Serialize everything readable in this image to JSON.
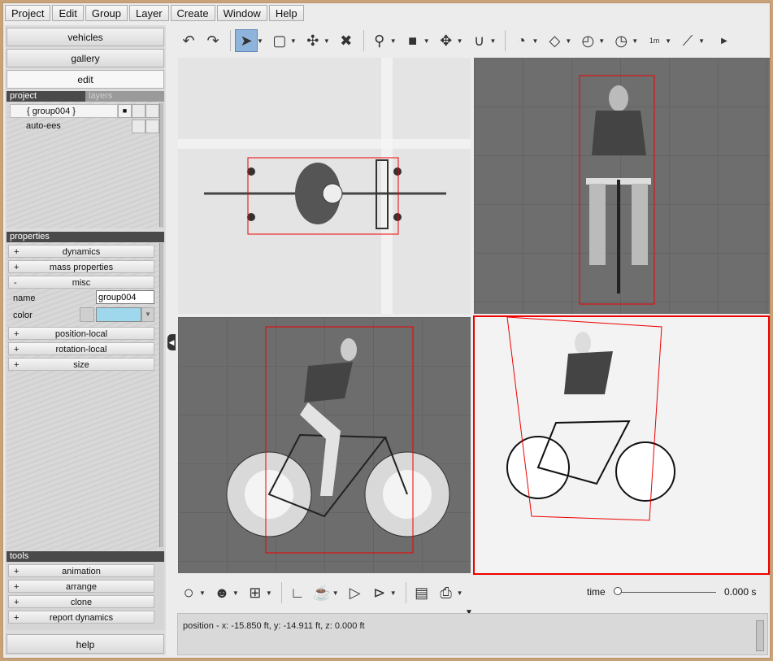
{
  "menubar": {
    "items": [
      "Project",
      "Edit",
      "Group",
      "Layer",
      "Create",
      "Window",
      "Help"
    ]
  },
  "left_panel": {
    "nav": {
      "vehicles": "vehicles",
      "gallery": "gallery",
      "edit": "edit"
    },
    "tabs": {
      "project": "project",
      "layers": "layers"
    },
    "project_items": [
      {
        "label": "{ group004 }"
      },
      {
        "label": "auto-ees"
      }
    ],
    "properties": {
      "header": "properties",
      "dynamics": "dynamics",
      "mass_properties": "mass properties",
      "misc": "misc",
      "name_label": "name",
      "name_value": "group004",
      "color_label": "color",
      "color_value": "#9fd8ec",
      "position_local": "position-local",
      "rotation_local": "rotation-local",
      "size": "size",
      "plus": "+",
      "minus": "-"
    },
    "tools": {
      "header": "tools",
      "items": [
        "animation",
        "arrange",
        "clone",
        "report dynamics"
      ]
    },
    "help": "help"
  },
  "toolbar": {
    "icons": [
      "undo-icon",
      "redo-icon",
      "select-arrow-icon",
      "rectangle-select-icon",
      "gizmo-icon",
      "delete-icon",
      "zoom-icon",
      "box-icon",
      "move-icon",
      "magnet-icon",
      "rotate-dial-icon",
      "ruler-plane-icon",
      "angle-dial-icon",
      "angle-dial-2-icon",
      "measure-1m-icon",
      "knife-icon"
    ],
    "measure_label": "1m"
  },
  "bottom": {
    "time_label": "time",
    "time_value": "0.000 s",
    "time_fraction": 0.0,
    "status": "position - x: -15.850 ft, y: -14.911 ft, z: 0.000 ft"
  },
  "colors": {
    "selection_red": "#e00000",
    "toolbar_active": "#8fb4dc",
    "window_border": "#c9a27a"
  }
}
